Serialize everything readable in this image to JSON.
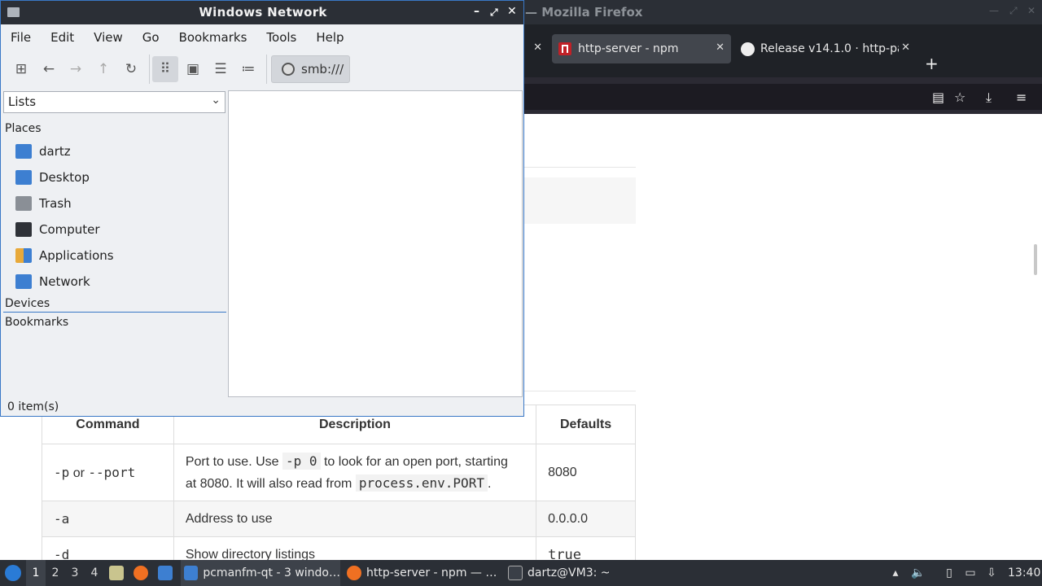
{
  "firefox": {
    "title": "— Mozilla Firefox",
    "tabs": [
      {
        "label": "",
        "close": "✕"
      },
      {
        "label": "http-server - npm",
        "close": "✕"
      },
      {
        "label": "Release v14.1.0 · http-pa",
        "close": "✕"
      }
    ],
    "new_tab": "+",
    "table": {
      "headers": [
        "Command",
        "Description",
        "Defaults"
      ],
      "rows": [
        {
          "cmd_a": "-p",
          "cmd_or": "or",
          "cmd_b": "--port",
          "desc_1": "Port to use. Use",
          "desc_code1": "-p 0",
          "desc_2": "to look for an open port, starting",
          "desc_3": "at 8080. It will also read from",
          "desc_code2": "process.env.PORT",
          "desc_4": ".",
          "default": "8080"
        },
        {
          "cmd": "-a",
          "desc": "Address to use",
          "default": "0.0.0.0"
        },
        {
          "cmd": "-d",
          "desc": "Show directory listings",
          "default": "true"
        }
      ]
    }
  },
  "filemanager": {
    "title": "Windows Network",
    "menu": [
      "File",
      "Edit",
      "View",
      "Go",
      "Bookmarks",
      "Tools",
      "Help"
    ],
    "path": "smb:///",
    "side_mode": "Lists",
    "places_header": "Places",
    "places": [
      {
        "label": "dartz",
        "icon": "home-folder-icon",
        "color": "#3d7fd1"
      },
      {
        "label": "Desktop",
        "icon": "desktop-icon",
        "color": "#3d7fd1"
      },
      {
        "label": "Trash",
        "icon": "trash-icon",
        "color": "#8a8f96"
      },
      {
        "label": "Computer",
        "icon": "computer-icon",
        "color": "#2f3238"
      },
      {
        "label": "Applications",
        "icon": "applications-icon",
        "color": "#e8a93a"
      },
      {
        "label": "Network",
        "icon": "network-icon",
        "color": "#3d7fd1"
      }
    ],
    "devices_header": "Devices",
    "bookmarks_header": "Bookmarks",
    "status": "0 item(s)"
  },
  "taskbar": {
    "workspaces": [
      "1",
      "2",
      "3",
      "4"
    ],
    "tasks": [
      {
        "label": "pcmanfm-qt - 3 windo…"
      },
      {
        "label": "http-server - npm — …"
      },
      {
        "label": "dartz@VM3: ~"
      }
    ],
    "clock": "13:40"
  }
}
